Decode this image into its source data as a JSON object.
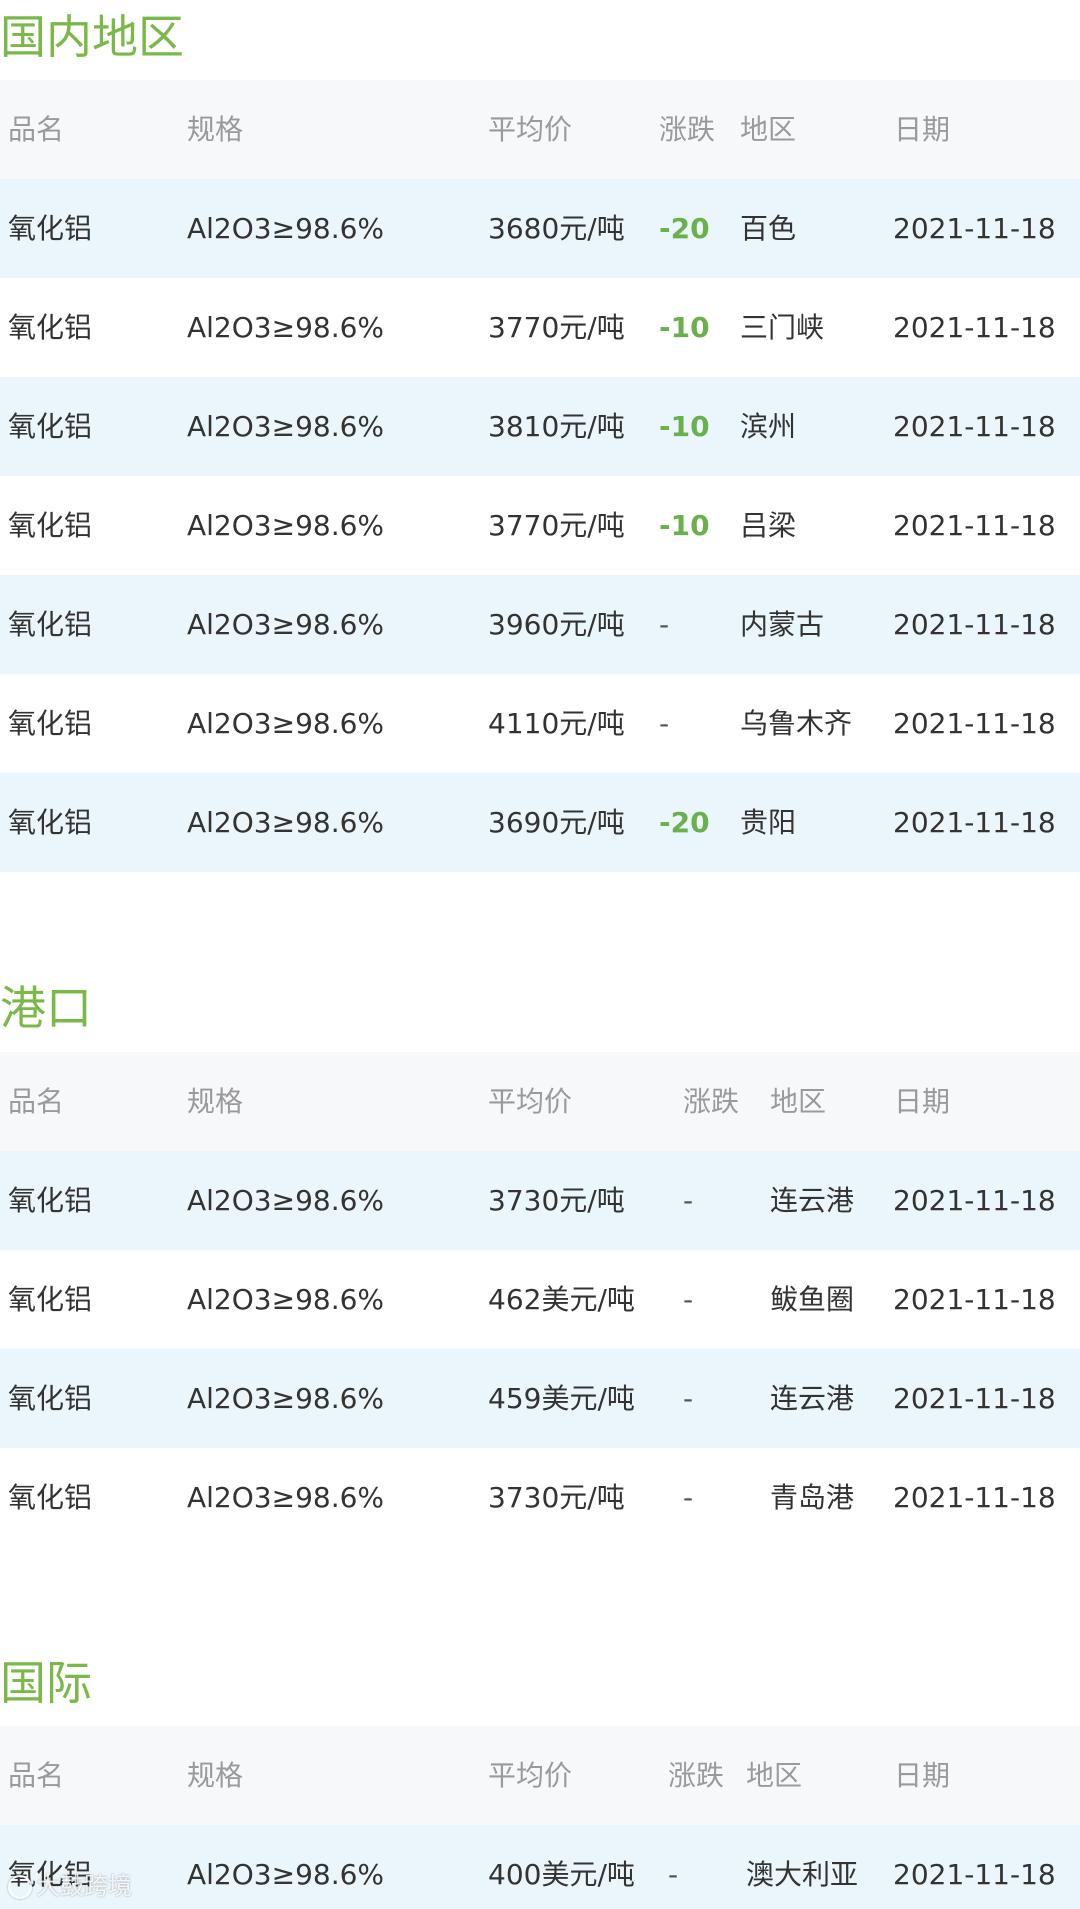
{
  "sections": [
    {
      "title": "国内地区",
      "columns": [
        "品名",
        "规格",
        "平均价",
        "涨跌",
        "地区",
        "日期"
      ],
      "rows": [
        {
          "name": "氧化铝",
          "spec": "Al2O3≥98.6%",
          "price": "3680元/吨",
          "change": "-20",
          "region": "百色",
          "date": "2021-11-18"
        },
        {
          "name": "氧化铝",
          "spec": "Al2O3≥98.6%",
          "price": "3770元/吨",
          "change": "-10",
          "region": "三门峡",
          "date": "2021-11-18"
        },
        {
          "name": "氧化铝",
          "spec": "Al2O3≥98.6%",
          "price": "3810元/吨",
          "change": "-10",
          "region": "滨州",
          "date": "2021-11-18"
        },
        {
          "name": "氧化铝",
          "spec": "Al2O3≥98.6%",
          "price": "3770元/吨",
          "change": "-10",
          "region": "吕梁",
          "date": "2021-11-18"
        },
        {
          "name": "氧化铝",
          "spec": "Al2O3≥98.6%",
          "price": "3960元/吨",
          "change": "-",
          "region": "内蒙古",
          "date": "2021-11-18"
        },
        {
          "name": "氧化铝",
          "spec": "Al2O3≥98.6%",
          "price": "4110元/吨",
          "change": "-",
          "region": "乌鲁木齐",
          "date": "2021-11-18"
        },
        {
          "name": "氧化铝",
          "spec": "Al2O3≥98.6%",
          "price": "3690元/吨",
          "change": "-20",
          "region": "贵阳",
          "date": "2021-11-18"
        }
      ]
    },
    {
      "title": "港口",
      "columns": [
        "品名",
        "规格",
        "平均价",
        "涨跌",
        "地区",
        "日期"
      ],
      "rows": [
        {
          "name": "氧化铝",
          "spec": "Al2O3≥98.6%",
          "price": "3730元/吨",
          "change": "-",
          "region": "连云港",
          "date": "2021-11-18"
        },
        {
          "name": "氧化铝",
          "spec": "Al2O3≥98.6%",
          "price": "462美元/吨",
          "change": "-",
          "region": "鲅鱼圈",
          "date": "2021-11-18"
        },
        {
          "name": "氧化铝",
          "spec": "Al2O3≥98.6%",
          "price": "459美元/吨",
          "change": "-",
          "region": "连云港",
          "date": "2021-11-18"
        },
        {
          "name": "氧化铝",
          "spec": "Al2O3≥98.6%",
          "price": "3730元/吨",
          "change": "-",
          "region": "青岛港",
          "date": "2021-11-18"
        }
      ]
    },
    {
      "title": "国际",
      "columns": [
        "品名",
        "规格",
        "平均价",
        "涨跌",
        "地区",
        "日期"
      ],
      "rows": [
        {
          "name": "氧化铝",
          "spec": "Al2O3≥98.6%",
          "price": "400美元/吨",
          "change": "-",
          "region": "澳大利亚",
          "date": "2021-11-18"
        }
      ]
    }
  ],
  "watermark": "大鼓跨境",
  "colors": {
    "title_green": "#7bb84a",
    "change_down_green": "#6ab04c",
    "row_alt_blue": "#eaf6fc",
    "header_gray": "#f7f8fa"
  }
}
